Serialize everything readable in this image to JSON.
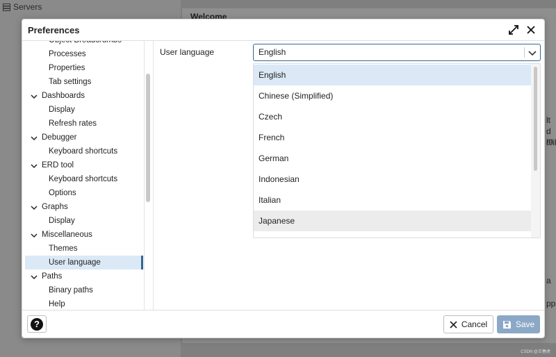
{
  "background": {
    "servers_label": "Servers",
    "welcome_label": "Welcome",
    "fragments": [
      "lt",
      "d m",
      "alik"
    ],
    "lower_fragments": [
      "a",
      "ppo"
    ],
    "watermark": "CSDN @王春虎"
  },
  "dialog": {
    "title": "Preferences",
    "expand_icon": "expand-icon",
    "close_icon": "close-icon"
  },
  "tree": {
    "items": [
      {
        "label": "Object Breadcrumbs",
        "level": 1
      },
      {
        "label": "Processes",
        "level": 1
      },
      {
        "label": "Properties",
        "level": 1
      },
      {
        "label": "Tab settings",
        "level": 1
      },
      {
        "label": "Dashboards",
        "level": 0
      },
      {
        "label": "Display",
        "level": 1
      },
      {
        "label": "Refresh rates",
        "level": 1
      },
      {
        "label": "Debugger",
        "level": 0
      },
      {
        "label": "Keyboard shortcuts",
        "level": 1
      },
      {
        "label": "ERD tool",
        "level": 0
      },
      {
        "label": "Keyboard shortcuts",
        "level": 1
      },
      {
        "label": "Options",
        "level": 1
      },
      {
        "label": "Graphs",
        "level": 0
      },
      {
        "label": "Display",
        "level": 1
      },
      {
        "label": "Miscellaneous",
        "level": 0
      },
      {
        "label": "Themes",
        "level": 1
      },
      {
        "label": "User language",
        "level": 1,
        "selected": true
      },
      {
        "label": "Paths",
        "level": 0
      },
      {
        "label": "Binary paths",
        "level": 1
      },
      {
        "label": "Help",
        "level": 1
      }
    ]
  },
  "content": {
    "field_label": "User language",
    "selected_value": "English",
    "options": [
      "English",
      "Chinese (Simplified)",
      "Czech",
      "French",
      "German",
      "Indonesian",
      "Italian",
      "Japanese"
    ],
    "hovered_option": "Japanese"
  },
  "footer": {
    "help_symbol": "?",
    "cancel_label": "Cancel",
    "save_label": "Save"
  },
  "colors": {
    "accent": "#326690",
    "selection": "#dbe9f6",
    "save_disabled": "#8ba8c6"
  }
}
